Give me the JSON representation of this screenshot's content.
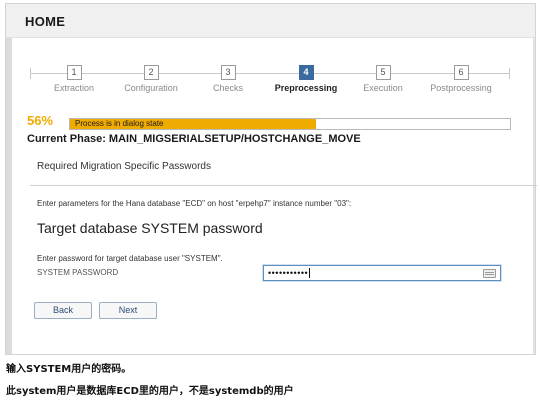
{
  "header": {
    "title": "HOME"
  },
  "steps": [
    {
      "num": "1",
      "label": "Extraction"
    },
    {
      "num": "2",
      "label": "Configuration"
    },
    {
      "num": "3",
      "label": "Checks"
    },
    {
      "num": "4",
      "label": "Preprocessing"
    },
    {
      "num": "5",
      "label": "Execution"
    },
    {
      "num": "6",
      "label": "Postprocessing"
    }
  ],
  "active_step": 4,
  "progress": {
    "percent_label": "56%",
    "value": 0.56,
    "status": "Process is in dialog state",
    "bar_color": "#f0ab00"
  },
  "phase": "Current Phase: MAIN_MIGSERIALSETUP/HOSTCHANGE_MOVE",
  "form": {
    "section_title": "Required Migration Specific Passwords",
    "params_text": "Enter parameters for the Hana database \"ECD\" on host \"erpehp7\" instance number \"03\":",
    "heading": "Target database SYSTEM password",
    "password_description": "Enter password for target database user \"SYSTEM\".",
    "password_label": "SYSTEM PASSWORD",
    "password_value": "•••••••••••",
    "keyboard_icon": "keyboard-icon"
  },
  "buttons": {
    "back": "Back",
    "next": "Next"
  },
  "captions": [
    "输入SYSTEM用户的密码。",
    "此system用户是数据库ECD里的用户，不是systemdb的用户"
  ],
  "colors": {
    "active_step": "#3b6a9e",
    "accent": "#f0ab00",
    "button_text": "#2a4d77"
  }
}
